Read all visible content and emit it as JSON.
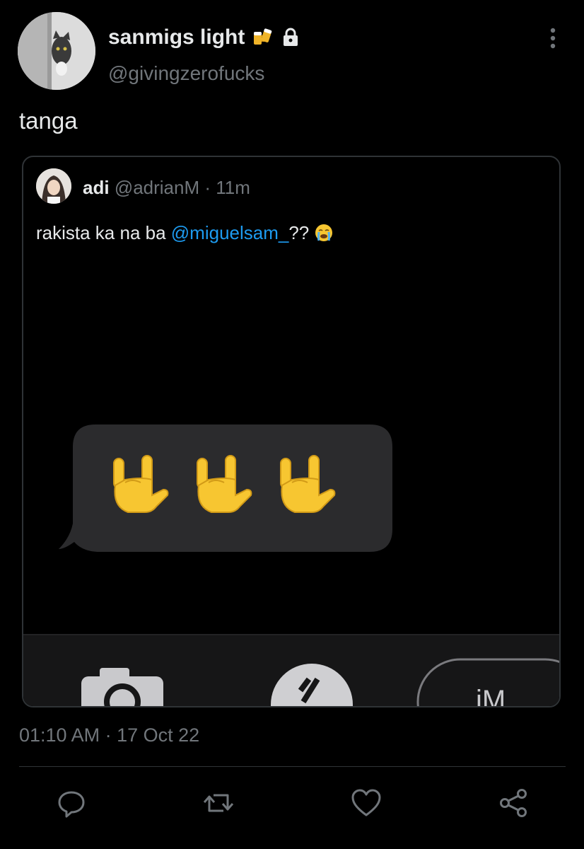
{
  "author": {
    "display_name": "sanmigs light",
    "name_emoji_icon": "beer-mugs-icon",
    "protected_icon": "lock-icon",
    "handle": "@givingzerofucks",
    "avatar_icon": "cat-photo-avatar"
  },
  "tweet": {
    "text": "tanga",
    "timestamp": "01:10 AM · 17 Oct 22"
  },
  "quote": {
    "avatar_icon": "person-photo-avatar",
    "name": "adi",
    "handle": "@adrianM",
    "time": "· 11m",
    "text_before": "rakista ka na ba ",
    "mention": "@miguelsam_",
    "text_after": "?? ",
    "text_emoji_icon": "crying-face-icon",
    "media": {
      "bubble_emojis": [
        "rock-on-hand-icon",
        "rock-on-hand-icon",
        "rock-on-hand-icon"
      ],
      "keyboard_partial_text": "iM"
    }
  },
  "actions": [
    "reply-icon",
    "retweet-icon",
    "like-icon",
    "share-icon"
  ],
  "colors": {
    "background": "#000000",
    "primary_text": "#e7e9ea",
    "secondary_text": "#71767b",
    "link": "#1d9bf0",
    "border": "#2f3336"
  }
}
